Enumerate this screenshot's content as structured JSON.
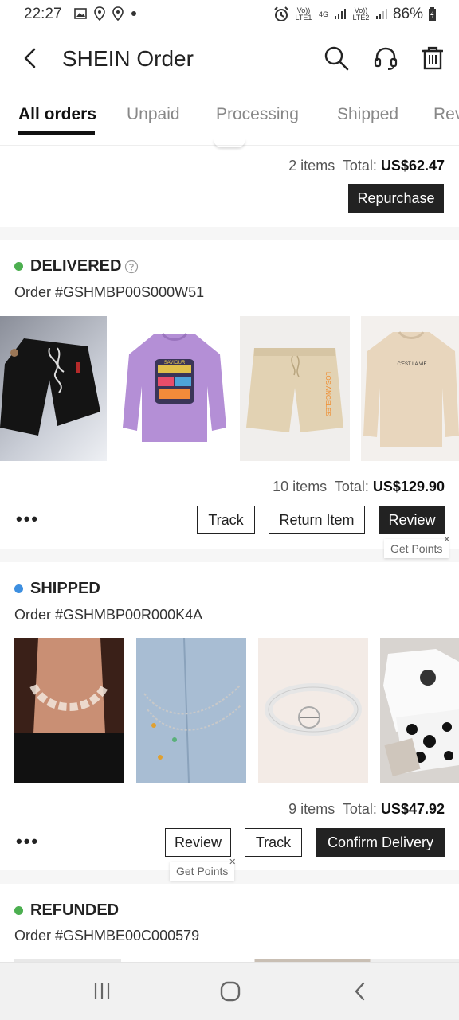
{
  "status_bar": {
    "time": "22:27",
    "battery": "86%",
    "sim1": "Vo)) LTE1",
    "sim2": "Vo)) LTE2",
    "net": "4G"
  },
  "app_bar": {
    "title": "SHEIN Order"
  },
  "tabs": [
    "All orders",
    "Unpaid",
    "Processing",
    "Shipped",
    "Rev"
  ],
  "partial_order": {
    "items": "2 items",
    "total_label": "Total:",
    "total": "US$62.47",
    "button": "Repurchase"
  },
  "orders": [
    {
      "status": "DELIVERED",
      "status_color": "#4caf50",
      "order_no": "Order #GSHMBP00S000W51",
      "items": "10 items",
      "total_label": "Total:",
      "total": "US$129.90",
      "buttons": [
        "Track",
        "Return Item",
        "Review"
      ],
      "tip": "Get Points",
      "thumb_print_1": "SAVIOUR",
      "thumb_print_2": "LOS ANGELES",
      "thumb_print_3": "C'EST LA VIE"
    },
    {
      "status": "SHIPPED",
      "status_color": "#3d8fe0",
      "order_no": "Order #GSHMBP00R000K4A",
      "items": "9 items",
      "total_label": "Total:",
      "total": "US$47.92",
      "buttons": [
        "Review",
        "Track",
        "Confirm Delivery"
      ],
      "tip": "Get Points"
    },
    {
      "status": "REFUNDED",
      "status_color": "#4caf50",
      "order_no": "Order #GSHMBE00C000579"
    }
  ],
  "more_label": "•••",
  "icons": [
    "back-arrow-icon",
    "search-icon",
    "headset-icon",
    "trash-icon",
    "help-circle-icon"
  ]
}
